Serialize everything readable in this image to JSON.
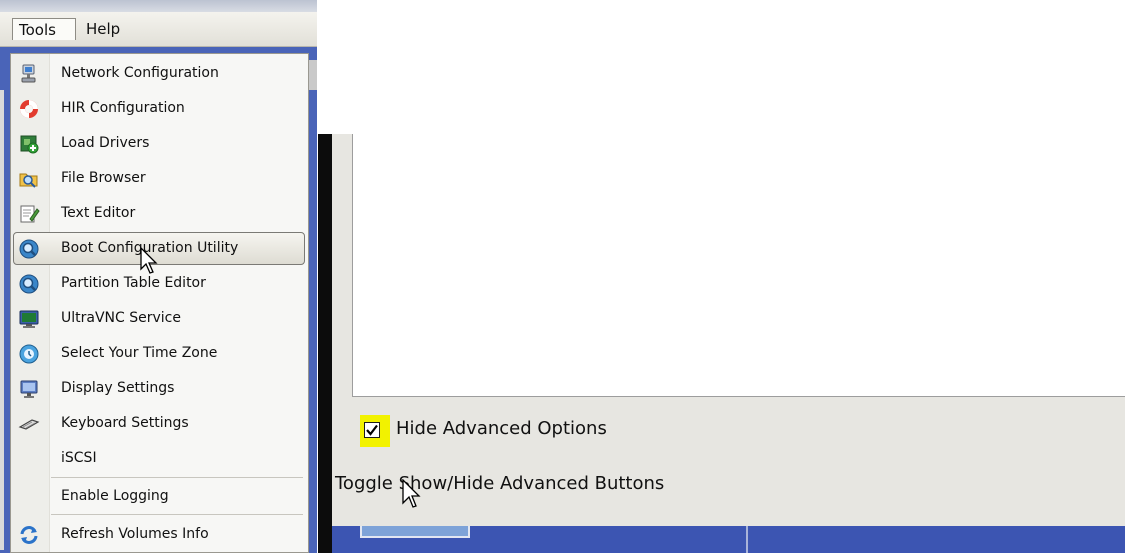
{
  "menubar": {
    "items": [
      {
        "label": "Tools"
      },
      {
        "label": "Help"
      }
    ]
  },
  "tools_menu": {
    "items": [
      {
        "label": "Network Configuration",
        "icon": "network-icon"
      },
      {
        "label": "HIR Configuration",
        "icon": "lifebuoy-icon"
      },
      {
        "label": "Load Drivers",
        "icon": "load-drivers-icon"
      },
      {
        "label": "File Browser",
        "icon": "folder-magnifier-icon"
      },
      {
        "label": "Text Editor",
        "icon": "notepad-icon"
      },
      {
        "label": "Boot Configuration Utility",
        "icon": "magnifier-icon",
        "highlighted": true
      },
      {
        "label": "Partition Table Editor",
        "icon": "magnifier-icon"
      },
      {
        "label": "UltraVNC Service",
        "icon": "vnc-monitor-icon"
      },
      {
        "label": "Select Your Time Zone",
        "icon": "globe-clock-icon"
      },
      {
        "label": "Display Settings",
        "icon": "monitor-icon"
      },
      {
        "label": "Keyboard Settings",
        "icon": "keyboard-icon"
      },
      {
        "label": "iSCSI",
        "icon": ""
      },
      {
        "label": "Enable Logging",
        "icon": ""
      },
      {
        "label": "Refresh Volumes Info",
        "icon": "refresh-icon"
      }
    ]
  },
  "dialog": {
    "hide_advanced_options": {
      "label": "Hide Advanced Options",
      "checked": true
    },
    "toggle_tooltip": "Toggle Show/Hide Advanced Buttons"
  },
  "colors": {
    "menu_background": "#f7f7f5",
    "desktop_blue": "#4a64b8",
    "checkbox_highlight": "#f2f200"
  }
}
